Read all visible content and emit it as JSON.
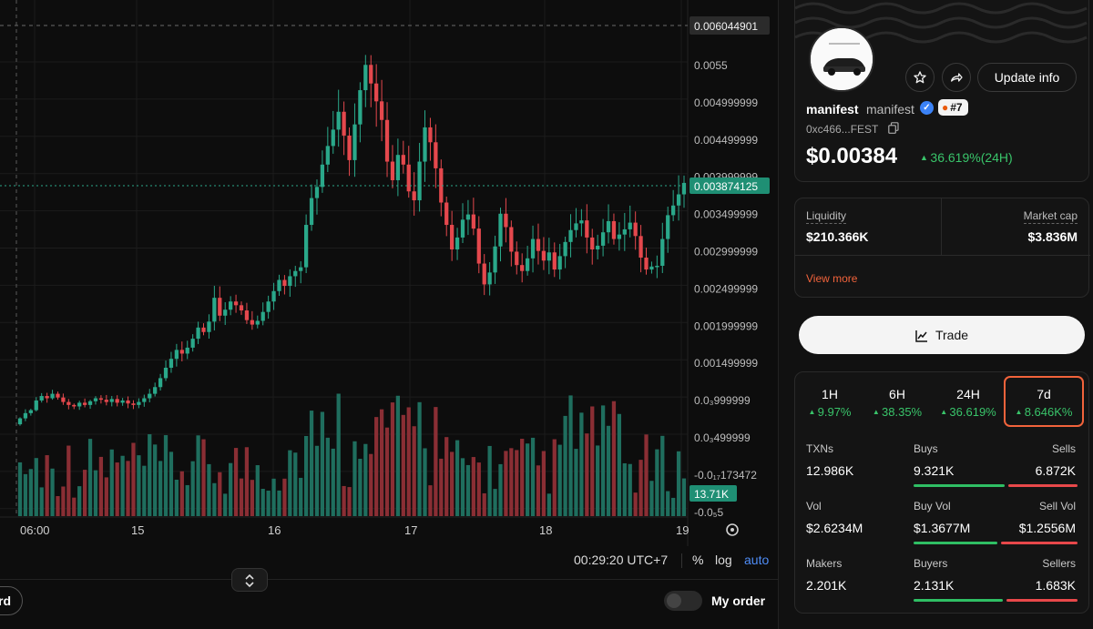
{
  "chart": {
    "price_labels": [
      "0.0055",
      "0.004999999",
      "0.004499999",
      "0.003999999",
      "0.003499999",
      "0.002999999",
      "0.002499999",
      "0.001999999",
      "0.001499999",
      "0.0₃999999",
      "0.0₃499999",
      "-0.0₁₇173472",
      "-0.0₅5"
    ],
    "crosshair_price": "0.006044901",
    "current_price": "0.003874125",
    "volume_label": "13.71K",
    "date_labels": [
      "06:00",
      "15",
      "16",
      "17",
      "18",
      "19"
    ],
    "clock": "00:29:20 UTC+7",
    "pct_label": "%",
    "log_label": "log",
    "auto_label": "auto",
    "collapse_icon": "chevrons-up-down-icon",
    "left_pill_text": "rd",
    "my_order_label": "My order",
    "colors": {
      "up": "#2aa88a",
      "down": "#e5484d",
      "up_vol": "#1f6e5e",
      "down_vol": "#8a2e34"
    }
  },
  "token": {
    "symbol": "manifest",
    "name": "manifest",
    "rank": "#7",
    "address": "0xc466...FEST",
    "price": "$0.00384",
    "change_24h": "36.619%(24H)",
    "update_label": "Update info"
  },
  "stats": {
    "liquidity_label": "Liquidity",
    "liquidity_value": "$210.366K",
    "mcap_label": "Market cap",
    "mcap_value": "$3.836M",
    "view_more": "View more"
  },
  "trade_label": "Trade",
  "timeframes": [
    {
      "label": "1H",
      "value": "9.97%"
    },
    {
      "label": "6H",
      "value": "38.35%"
    },
    {
      "label": "24H",
      "value": "36.619%"
    },
    {
      "label": "7d",
      "value": "8.646K%"
    }
  ],
  "metrics": {
    "txns_label": "TXNs",
    "txns_value": "12.986K",
    "buys_label": "Buys",
    "buys_value": "9.321K",
    "sells_label": "Sells",
    "sells_value": "6.872K",
    "vol_label": "Vol",
    "vol_value": "$2.6234M",
    "buy_vol_label": "Buy Vol",
    "buy_vol_value": "$1.3677M",
    "sell_vol_label": "Sell Vol",
    "sell_vol_value": "$1.2556M",
    "makers_label": "Makers",
    "makers_value": "2.201K",
    "buyers_label": "Buyers",
    "buyers_value": "2.131K",
    "sellers_label": "Sellers",
    "sellers_value": "1.683K"
  }
}
